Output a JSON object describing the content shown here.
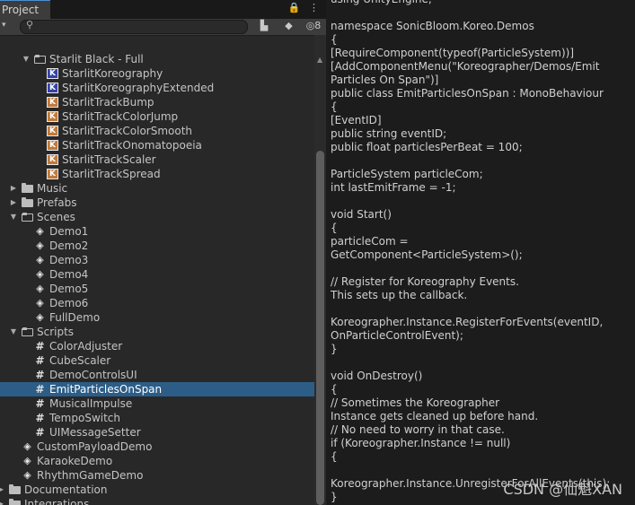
{
  "project": {
    "tab_label": "Project",
    "tab_tools": {
      "lock": "🔒",
      "menu": "⋮"
    },
    "toolbar": {
      "search_placeholder": "",
      "hidden_count": "8"
    },
    "tree": [
      {
        "label": "Starlit Black - Full",
        "icon": "folder-open-icon",
        "indent": 2,
        "arrow": "down"
      },
      {
        "label": "StarlitKoreography",
        "icon": "koreography-icon",
        "indent": 3,
        "arrow": ""
      },
      {
        "label": "StarlitKoreographyExtended",
        "icon": "koreography-icon",
        "indent": 3,
        "arrow": ""
      },
      {
        "label": "StarlitTrackBump",
        "icon": "koreography-track-icon",
        "indent": 3,
        "arrow": ""
      },
      {
        "label": "StarlitTrackColorJump",
        "icon": "koreography-track-icon",
        "indent": 3,
        "arrow": ""
      },
      {
        "label": "StarlitTrackColorSmooth",
        "icon": "koreography-track-icon",
        "indent": 3,
        "arrow": ""
      },
      {
        "label": "StarlitTrackOnomatopoeia",
        "icon": "koreography-track-icon",
        "indent": 3,
        "arrow": ""
      },
      {
        "label": "StarlitTrackScaler",
        "icon": "koreography-track-icon",
        "indent": 3,
        "arrow": ""
      },
      {
        "label": "StarlitTrackSpread",
        "icon": "koreography-track-icon",
        "indent": 3,
        "arrow": ""
      },
      {
        "label": "Music",
        "icon": "folder-icon",
        "indent": 1,
        "arrow": "right"
      },
      {
        "label": "Prefabs",
        "icon": "folder-icon",
        "indent": 1,
        "arrow": "right"
      },
      {
        "label": "Scenes",
        "icon": "folder-open-icon",
        "indent": 1,
        "arrow": "down"
      },
      {
        "label": "Demo1",
        "icon": "unity-scene-icon",
        "indent": 2,
        "arrow": ""
      },
      {
        "label": "Demo2",
        "icon": "unity-scene-icon",
        "indent": 2,
        "arrow": ""
      },
      {
        "label": "Demo3",
        "icon": "unity-scene-icon",
        "indent": 2,
        "arrow": ""
      },
      {
        "label": "Demo4",
        "icon": "unity-scene-icon",
        "indent": 2,
        "arrow": ""
      },
      {
        "label": "Demo5",
        "icon": "unity-scene-icon",
        "indent": 2,
        "arrow": ""
      },
      {
        "label": "Demo6",
        "icon": "unity-scene-icon",
        "indent": 2,
        "arrow": ""
      },
      {
        "label": "FullDemo",
        "icon": "unity-scene-icon",
        "indent": 2,
        "arrow": ""
      },
      {
        "label": "Scripts",
        "icon": "folder-open-icon",
        "indent": 1,
        "arrow": "down"
      },
      {
        "label": "ColorAdjuster",
        "icon": "csharp-script-icon",
        "indent": 2,
        "arrow": ""
      },
      {
        "label": "CubeScaler",
        "icon": "csharp-script-icon",
        "indent": 2,
        "arrow": ""
      },
      {
        "label": "DemoControlsUI",
        "icon": "csharp-script-icon",
        "indent": 2,
        "arrow": ""
      },
      {
        "label": "EmitParticlesOnSpan",
        "icon": "csharp-script-icon",
        "indent": 2,
        "arrow": "",
        "selected": true
      },
      {
        "label": "MusicalImpulse",
        "icon": "csharp-script-icon",
        "indent": 2,
        "arrow": ""
      },
      {
        "label": "TempoSwitch",
        "icon": "csharp-script-icon",
        "indent": 2,
        "arrow": ""
      },
      {
        "label": "UIMessageSetter",
        "icon": "csharp-script-icon",
        "indent": 2,
        "arrow": ""
      },
      {
        "label": "CustomPayloadDemo",
        "icon": "unity-scene-icon",
        "indent": 1,
        "arrow": ""
      },
      {
        "label": "KaraokeDemo",
        "icon": "unity-scene-icon",
        "indent": 1,
        "arrow": ""
      },
      {
        "label": "RhythmGameDemo",
        "icon": "unity-scene-icon",
        "indent": 1,
        "arrow": ""
      },
      {
        "label": "Documentation",
        "icon": "folder-icon",
        "indent": 0,
        "arrow": "right"
      },
      {
        "label": "Integrations",
        "icon": "folder-icon",
        "indent": 0,
        "arrow": "right"
      }
    ]
  },
  "code": {
    "lines": [
      "using UnityEngine;",
      "",
      "namespace SonicBloom.Koreo.Demos",
      "{",
      "                [RequireComponent(typeof(ParticleSystem))]",
      "                [AddComponentMenu(\"Koreographer/Demos/Emit",
      "Particles On Span\")]",
      "                public class EmitParticlesOnSpan : MonoBehaviour",
      "                {",
      "                                [EventID]",
      "                                public string eventID;",
      "                                public float particlesPerBeat = 100;",
      "",
      "                                ParticleSystem particleCom;",
      "                                int lastEmitFrame = -1;",
      "",
      "                                void Start()",
      "                                {",
      "                                                particleCom =",
      "GetComponent<ParticleSystem>();",
      "",
      "                                                // Register for Koreography Events.",
      "This sets up the callback.",
      "",
      "Koreographer.Instance.RegisterForEvents(eventID,",
      "OnParticleControlEvent);",
      "                                }",
      "",
      "                                void OnDestroy()",
      "                                {",
      "                                                // Sometimes the Koreographer",
      "Instance gets cleaned up before hand.",
      "                                                //  No need to worry in that case.",
      "                                                if (Koreographer.Instance != null)",
      "                                                {",
      "",
      "Koreographer.Instance.UnregisterForAllEvents(this);",
      "                                                }"
    ]
  },
  "watermark": "CSDN @仙魁XAN"
}
